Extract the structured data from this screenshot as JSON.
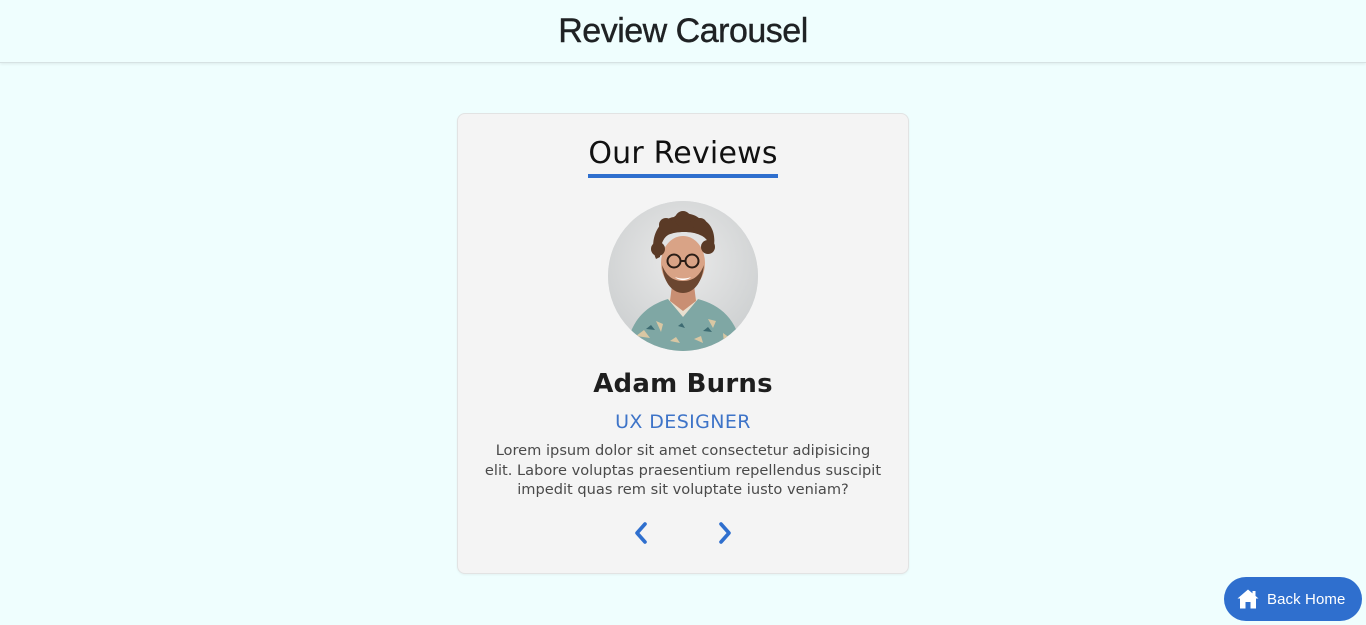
{
  "header": {
    "title": "Review Carousel"
  },
  "review_card": {
    "section_title": "Our Reviews",
    "name": "Adam Burns",
    "role": "UX DESIGNER",
    "text": "Lorem ipsum dolor sit amet consectetur adipisicing elit. Labore voluptas praesentium repellendus suscipit impedit quas rem sit voluptate iusto veniam?",
    "avatar_icon": "person-photo",
    "prev_icon": "chevron-left-icon",
    "next_icon": "chevron-right-icon"
  },
  "back_home": {
    "label": "Back Home",
    "icon": "home-icon"
  },
  "colors": {
    "background": "#effefe",
    "card": "#f4f4f4",
    "accent": "#2f6fce",
    "role": "#3e74c8"
  }
}
